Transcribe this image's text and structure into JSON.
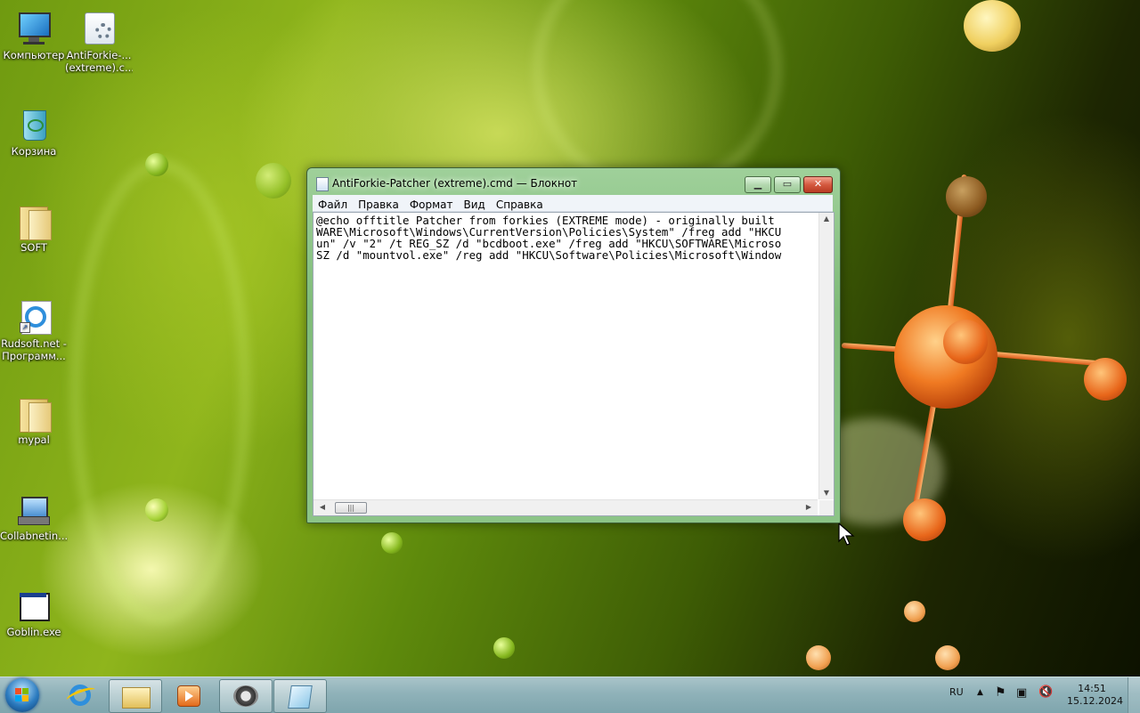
{
  "desktop": {
    "icons": [
      {
        "label": "Компьютер",
        "icon": "computer-icon"
      },
      {
        "label": "AntiForkie-...(extreme).c...",
        "line1": "AntiForkie-...",
        "line2": "(extreme).c...",
        "icon": "cmd-file-icon"
      },
      {
        "label": "Корзина",
        "icon": "recycle-bin-icon"
      },
      {
        "label": "SOFT",
        "icon": "folder-icon"
      },
      {
        "label": "Rudsoft.net - Программ...",
        "line1": "Rudsoft.net -",
        "line2": "Программ...",
        "icon": "internet-explorer-shortcut-icon"
      },
      {
        "label": "mypal",
        "icon": "folder-icon"
      },
      {
        "label": "Collabnetin...",
        "icon": "network-installer-icon"
      },
      {
        "label": "Goblin.exe",
        "icon": "application-icon"
      }
    ]
  },
  "notepad": {
    "title": "AntiForkie-Patcher (extreme).cmd — Блокнот",
    "menus": [
      "Файл",
      "Правка",
      "Формат",
      "Вид",
      "Справка"
    ],
    "content_lines": [
      "@echo offtitle Patcher from forkies (EXTREME mode) - originally built",
      "WARE\\Microsoft\\Windows\\CurrentVersion\\Policies\\System\" /freg add \"HKCU",
      "un\" /v \"2\" /t REG_SZ /d \"bcdboot.exe\" /freg add \"HKCU\\SOFTWARE\\Microso",
      "SZ /d \"mountvol.exe\" /reg add \"HKCU\\Software\\Policies\\Microsoft\\Window"
    ],
    "buttons": {
      "minimize": "minimize",
      "maximize": "maximize",
      "close": "close"
    }
  },
  "taskbar": {
    "pinned": [
      {
        "name": "internet-explorer",
        "icon": "internet-explorer-icon"
      },
      {
        "name": "explorer",
        "icon": "folder-library-icon"
      },
      {
        "name": "media-player",
        "icon": "media-player-icon"
      },
      {
        "name": "goblin",
        "icon": "raccoon-app-icon"
      },
      {
        "name": "notepad",
        "icon": "notepad-icon"
      }
    ],
    "tray": {
      "language": "RU",
      "time": "14:51",
      "date": "15.12.2024"
    }
  }
}
